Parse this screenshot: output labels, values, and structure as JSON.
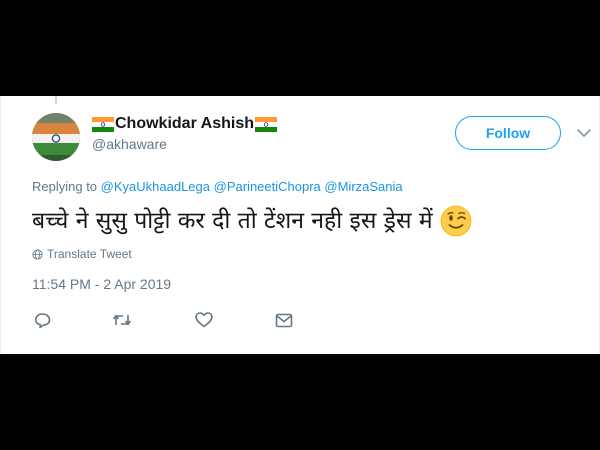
{
  "tweet": {
    "author": {
      "display_name": "Chowkidar Ashish",
      "handle": "@akhaware",
      "flag_emoji": "flag-india",
      "avatar_icon": "avatar-india-flag"
    },
    "follow_label": "Follow",
    "reply": {
      "prefix": "Replying to",
      "mentions": [
        "@KyaUkhaadLega",
        "@ParineetiChopra",
        "@MirzaSania"
      ]
    },
    "text": "बच्चे ने सुसु पोट्टी कर दी तो टेंशन नही इस ड्रेस में",
    "emoji": "winking-face",
    "translate_label": "Translate Tweet",
    "timestamp": "11:54 PM - 2 Apr 2019",
    "actions": [
      "reply-icon",
      "retweet-icon",
      "like-icon",
      "message-icon"
    ]
  },
  "colors": {
    "accent": "#1da1f2",
    "mention": "#1b95e0",
    "secondary_text": "#657786",
    "primary_text": "#14171a",
    "letterbox": "#000000"
  }
}
